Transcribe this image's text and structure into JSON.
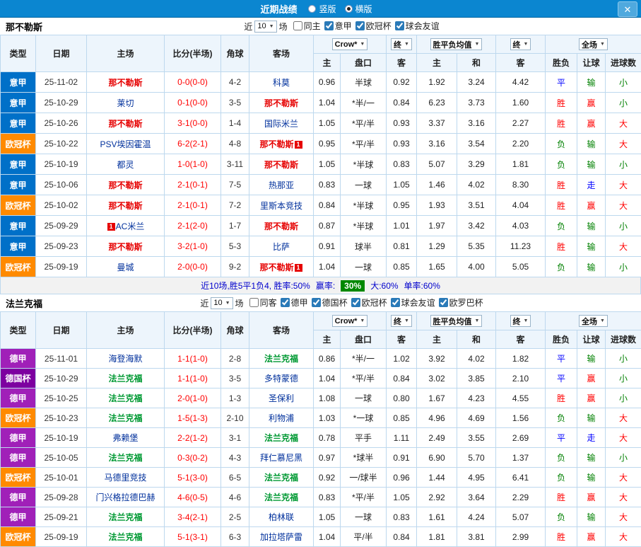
{
  "titlebar": {
    "title": "近期战绩",
    "layout_options": [
      {
        "label": "竖版",
        "selected": false
      },
      {
        "label": "横版",
        "selected": true
      }
    ]
  },
  "icons": {
    "chevron_down": "▼",
    "close": "✕"
  },
  "league_colors": {
    "意甲": "#0070c8",
    "欧冠杯": "#ff8a00",
    "德甲": "#a020b8",
    "德国杯": "#7d00a0"
  },
  "result_colors": {
    "胜": "#ff0000",
    "平": "#0000ff",
    "负": "#008000",
    "赢": "#ff0000",
    "输": "#008000",
    "走": "#0000ff",
    "大": "#ff0000",
    "小": "#008000"
  },
  "opponent_color": "#00309c",
  "table_header": {
    "type": "类型",
    "date": "日期",
    "home": "主场",
    "score": "比分(半场)",
    "corner": "角球",
    "away": "客场",
    "odds_company": "Crow*",
    "final1": "终",
    "avg": "胜平负均值",
    "final2": "终",
    "scope": "全场",
    "sub_home": "主",
    "sub_handicap": "盘口",
    "sub_away": "客",
    "sub_win": "主",
    "sub_draw": "和",
    "sub_lose": "客",
    "sub_result": "胜负",
    "sub_handicap_result": "让球",
    "sub_goals": "进球数"
  },
  "sections": [
    {
      "team": "那不勒斯",
      "team_color": "#e60000",
      "near_label": "近",
      "count": "10",
      "games_label": "场",
      "filters": [
        {
          "label": "同主",
          "checked": false
        },
        {
          "label": "意甲",
          "checked": true
        },
        {
          "label": "欧冠杯",
          "checked": true
        },
        {
          "label": "球会友谊",
          "checked": true
        }
      ],
      "rows": [
        {
          "league": "意甲",
          "date": "25-11-02",
          "home": "那不勒斯",
          "score": "0-0(0-0)",
          "corner": "4-2",
          "away": "科莫",
          "odds": [
            "0.96",
            "半球",
            "0.92",
            "1.92",
            "3.24",
            "4.42"
          ],
          "results": [
            "平",
            "输",
            "小"
          ]
        },
        {
          "league": "意甲",
          "date": "25-10-29",
          "home": "莱切",
          "score": "0-1(0-0)",
          "corner": "3-5",
          "away": "那不勒斯",
          "odds": [
            "1.04",
            "*半/一",
            "0.84",
            "6.23",
            "3.73",
            "1.60"
          ],
          "results": [
            "胜",
            "赢",
            "小"
          ]
        },
        {
          "league": "意甲",
          "date": "25-10-26",
          "home": "那不勒斯",
          "score": "3-1(0-0)",
          "corner": "1-4",
          "away": "国际米兰",
          "odds": [
            "1.05",
            "*平/半",
            "0.93",
            "3.37",
            "3.16",
            "2.27"
          ],
          "results": [
            "胜",
            "赢",
            "大"
          ]
        },
        {
          "league": "欧冠杯",
          "date": "25-10-22",
          "home": "PSV埃因霍温",
          "score": "6-2(2-1)",
          "corner": "4-8",
          "away": "那不勒斯",
          "away_badge": "1",
          "odds": [
            "0.95",
            "*平/半",
            "0.93",
            "3.16",
            "3.54",
            "2.20"
          ],
          "results": [
            "负",
            "输",
            "大"
          ]
        },
        {
          "league": "意甲",
          "date": "25-10-19",
          "home": "都灵",
          "score": "1-0(1-0)",
          "corner": "3-11",
          "away": "那不勒斯",
          "odds": [
            "1.05",
            "*半球",
            "0.83",
            "5.07",
            "3.29",
            "1.81"
          ],
          "results": [
            "负",
            "输",
            "小"
          ]
        },
        {
          "league": "意甲",
          "date": "25-10-06",
          "home": "那不勒斯",
          "score": "2-1(0-1)",
          "corner": "7-5",
          "away": "热那亚",
          "odds": [
            "0.83",
            "一球",
            "1.05",
            "1.46",
            "4.02",
            "8.30"
          ],
          "results": [
            "胜",
            "走",
            "大"
          ]
        },
        {
          "league": "欧冠杯",
          "date": "25-10-02",
          "home": "那不勒斯",
          "score": "2-1(0-1)",
          "corner": "7-2",
          "away": "里斯本竞技",
          "odds": [
            "0.84",
            "*半球",
            "0.95",
            "1.93",
            "3.51",
            "4.04"
          ],
          "results": [
            "胜",
            "赢",
            "大"
          ]
        },
        {
          "league": "意甲",
          "date": "25-09-29",
          "home": "AC米兰",
          "home_badge": "1",
          "score": "2-1(2-0)",
          "corner": "1-7",
          "away": "那不勒斯",
          "odds": [
            "0.87",
            "*半球",
            "1.01",
            "1.97",
            "3.42",
            "4.03"
          ],
          "results": [
            "负",
            "输",
            "小"
          ]
        },
        {
          "league": "意甲",
          "date": "25-09-23",
          "home": "那不勒斯",
          "score": "3-2(1-0)",
          "corner": "5-3",
          "away": "比萨",
          "odds": [
            "0.91",
            "球半",
            "0.81",
            "1.29",
            "5.35",
            "11.23"
          ],
          "results": [
            "胜",
            "输",
            "大"
          ]
        },
        {
          "league": "欧冠杯",
          "date": "25-09-19",
          "home": "曼城",
          "score": "2-0(0-0)",
          "corner": "9-2",
          "away": "那不勒斯",
          "away_badge": "1",
          "odds": [
            "1.04",
            "一球",
            "0.85",
            "1.65",
            "4.00",
            "5.05"
          ],
          "results": [
            "负",
            "输",
            "小"
          ]
        }
      ],
      "summary": {
        "text1": "近10场,胜5平1负4, 胜率:50%",
        "text2": "赢率:",
        "badge": "30%",
        "text3": "大:60%",
        "text4": "单率:60%"
      }
    },
    {
      "team": "法兰克福",
      "team_color": "#009933",
      "near_label": "近",
      "count": "10",
      "games_label": "场",
      "filters": [
        {
          "label": "同客",
          "checked": false
        },
        {
          "label": "德甲",
          "checked": true
        },
        {
          "label": "德国杯",
          "checked": true
        },
        {
          "label": "欧冠杯",
          "checked": true
        },
        {
          "label": "球会友谊",
          "checked": true
        },
        {
          "label": "欧罗巴杯",
          "checked": true
        }
      ],
      "rows": [
        {
          "league": "德甲",
          "date": "25-11-01",
          "home": "海登海默",
          "score": "1-1(1-0)",
          "corner": "2-8",
          "away": "法兰克福",
          "odds": [
            "0.86",
            "*半/一",
            "1.02",
            "3.92",
            "4.02",
            "1.82"
          ],
          "results": [
            "平",
            "输",
            "小"
          ]
        },
        {
          "league": "德国杯",
          "date": "25-10-29",
          "home": "法兰克福",
          "score": "1-1(1-0)",
          "corner": "3-5",
          "away": "多特蒙德",
          "odds": [
            "1.04",
            "*平/半",
            "0.84",
            "3.02",
            "3.85",
            "2.10"
          ],
          "results": [
            "平",
            "赢",
            "小"
          ]
        },
        {
          "league": "德甲",
          "date": "25-10-25",
          "home": "法兰克福",
          "score": "2-0(1-0)",
          "corner": "1-3",
          "away": "圣保利",
          "odds": [
            "1.08",
            "一球",
            "0.80",
            "1.67",
            "4.23",
            "4.55"
          ],
          "results": [
            "胜",
            "赢",
            "小"
          ]
        },
        {
          "league": "欧冠杯",
          "date": "25-10-23",
          "home": "法兰克福",
          "score": "1-5(1-3)",
          "corner": "2-10",
          "away": "利物浦",
          "odds": [
            "1.03",
            "*一球",
            "0.85",
            "4.96",
            "4.69",
            "1.56"
          ],
          "results": [
            "负",
            "输",
            "大"
          ]
        },
        {
          "league": "德甲",
          "date": "25-10-19",
          "home": "弗赖堡",
          "score": "2-2(1-2)",
          "corner": "3-1",
          "away": "法兰克福",
          "odds": [
            "0.78",
            "平手",
            "1.11",
            "2.49",
            "3.55",
            "2.69"
          ],
          "results": [
            "平",
            "走",
            "大"
          ]
        },
        {
          "league": "德甲",
          "date": "25-10-05",
          "home": "法兰克福",
          "score": "0-3(0-2)",
          "corner": "4-3",
          "away": "拜仁慕尼黑",
          "odds": [
            "0.97",
            "*球半",
            "0.91",
            "6.90",
            "5.70",
            "1.37"
          ],
          "results": [
            "负",
            "输",
            "小"
          ]
        },
        {
          "league": "欧冠杯",
          "date": "25-10-01",
          "home": "马德里竞技",
          "score": "5-1(3-0)",
          "corner": "6-5",
          "away": "法兰克福",
          "odds": [
            "0.92",
            "一/球半",
            "0.96",
            "1.44",
            "4.95",
            "6.41"
          ],
          "results": [
            "负",
            "输",
            "大"
          ]
        },
        {
          "league": "德甲",
          "date": "25-09-28",
          "home": "门兴格拉德巴赫",
          "score": "4-6(0-5)",
          "corner": "4-6",
          "away": "法兰克福",
          "odds": [
            "0.83",
            "*平/半",
            "1.05",
            "2.92",
            "3.64",
            "2.29"
          ],
          "results": [
            "胜",
            "赢",
            "大"
          ]
        },
        {
          "league": "德甲",
          "date": "25-09-21",
          "home": "法兰克福",
          "score": "3-4(2-1)",
          "corner": "2-5",
          "away": "柏林联",
          "odds": [
            "1.05",
            "一球",
            "0.83",
            "1.61",
            "4.24",
            "5.07"
          ],
          "results": [
            "负",
            "输",
            "大"
          ]
        },
        {
          "league": "欧冠杯",
          "date": "25-09-19",
          "home": "法兰克福",
          "score": "5-1(3-1)",
          "corner": "6-3",
          "away": "加拉塔萨雷",
          "odds": [
            "1.04",
            "平/半",
            "0.84",
            "1.81",
            "3.81",
            "2.99"
          ],
          "results": [
            "胜",
            "赢",
            "大"
          ]
        }
      ]
    }
  ]
}
